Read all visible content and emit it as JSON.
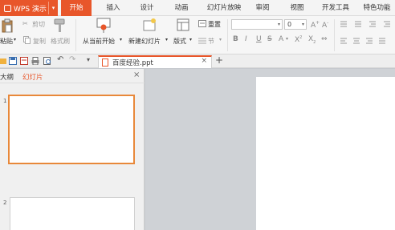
{
  "menubar": {
    "app_name": "WPS 演示",
    "tabs": [
      {
        "label": "开始",
        "active": true
      },
      {
        "label": "插入"
      },
      {
        "label": "设计"
      },
      {
        "label": "动画"
      },
      {
        "label": "幻灯片放映"
      },
      {
        "label": "审阅"
      },
      {
        "label": "视图"
      },
      {
        "label": "开发工具"
      },
      {
        "label": "特色功能"
      }
    ]
  },
  "ribbon": {
    "paste": "粘贴",
    "cut": "剪切",
    "copy": "复制",
    "format_painter": "格式刷",
    "from_current": "从当前开始",
    "new_slide": "新建幻灯片",
    "layout": "版式",
    "reset": "重置",
    "section": "节",
    "font_size": "0",
    "font_buttons": [
      "B",
      "I",
      "U",
      "S"
    ]
  },
  "tabs_bar": {
    "doc_name": "百度经验.ppt",
    "close": "×",
    "add": "+"
  },
  "left_panel": {
    "tab_outline": "大纲",
    "tab_slides": "幻灯片",
    "close": "×",
    "slide_numbers": [
      "1",
      "2"
    ]
  },
  "colors": {
    "accent": "#e8562a",
    "thumb_selected": "#e8883a",
    "canvas": "#cfd2d6"
  }
}
